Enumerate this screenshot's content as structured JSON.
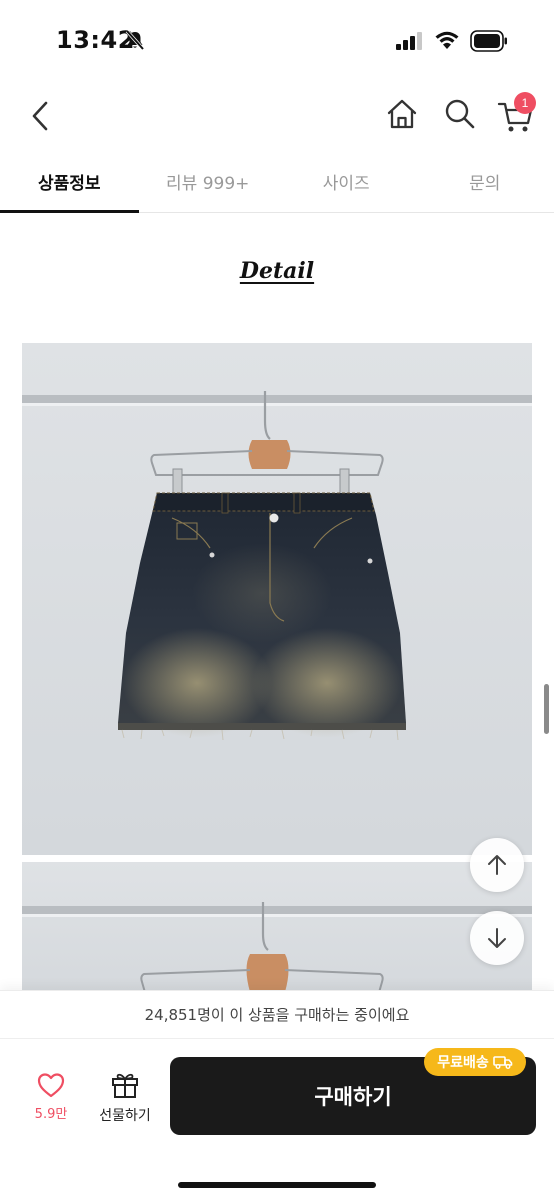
{
  "status_bar": {
    "time": "13:42",
    "icons": [
      "bell-off-icon",
      "signal-icon",
      "wifi-icon",
      "battery-icon"
    ]
  },
  "nav": {
    "icons": [
      "back-chevron-icon",
      "home-icon",
      "search-icon",
      "cart-icon"
    ],
    "cart_badge": "1"
  },
  "tabs": [
    {
      "label": "상품정보",
      "active": true
    },
    {
      "label": "리뷰 999+",
      "active": false
    },
    {
      "label": "사이즈",
      "active": false
    },
    {
      "label": "문의",
      "active": false
    }
  ],
  "detail": {
    "title": "Detail"
  },
  "notice": {
    "text": "24,851명이 이 상품을 구매하는 중이에요"
  },
  "bottom_bar": {
    "like_count": "5.9만",
    "gift_label": "선물하기",
    "buy_label": "구매하기",
    "shipping_badge": "무료배송"
  },
  "colors": {
    "accent_red": "#ef4e62",
    "buy_button": "#1a1a1a",
    "shipping_badge": "#f6b81a"
  }
}
